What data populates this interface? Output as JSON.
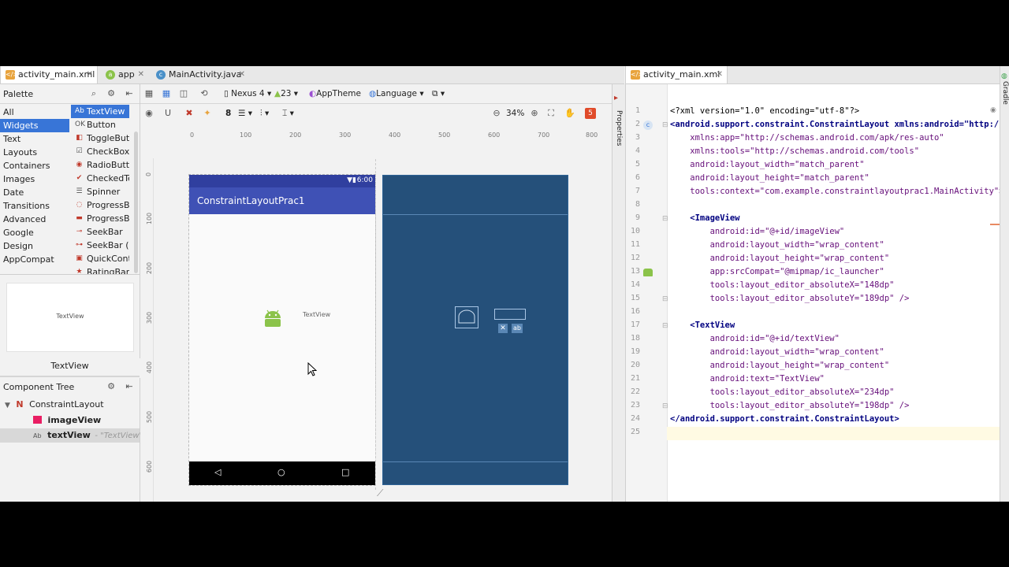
{
  "left_tabs": [
    {
      "label": "activity_main.xml",
      "icon": "xml-file-icon"
    },
    {
      "label": "app",
      "icon": "android-module-icon"
    },
    {
      "label": "MainActivity.java",
      "icon": "java-class-icon"
    }
  ],
  "right_tab": {
    "label": "activity_main.xml"
  },
  "palette": {
    "title": "Palette",
    "categories": [
      "All",
      "Widgets",
      "Text",
      "Layouts",
      "Containers",
      "Images",
      "Date",
      "Transitions",
      "Advanced",
      "Google",
      "Design",
      "AppCompat"
    ],
    "selected_category": "Widgets",
    "widgets": [
      "TextView",
      "Button",
      "ToggleButto",
      "CheckBox",
      "RadioButtor",
      "CheckedTex",
      "Spinner",
      "ProgressBar",
      "ProgressBar",
      "SeekBar",
      "SeekBar (Di",
      "QuickConta",
      "RatingBar"
    ],
    "preview_text": "TextView",
    "preview_caption": "TextView"
  },
  "toolbar": {
    "device": "Nexus 4",
    "api": "23",
    "theme": "AppTheme",
    "language": "Language",
    "margin": "8",
    "zoom": "34%",
    "error_count": "5"
  },
  "ruler": {
    "top": [
      "0",
      "100",
      "200",
      "300",
      "400",
      "500",
      "600",
      "700",
      "800"
    ],
    "left": [
      "0",
      "100",
      "200",
      "300",
      "400",
      "500",
      "600"
    ]
  },
  "phone": {
    "status_time": "6:00",
    "app_title": "ConstraintLayoutPrac1",
    "textview_text": "TextView"
  },
  "component_tree": {
    "title": "Component Tree",
    "root": "ConstraintLayout",
    "children": [
      {
        "name": "imageView",
        "hint": ""
      },
      {
        "name": "textView",
        "hint": "- \"TextView\""
      }
    ]
  },
  "side_strip": {
    "properties": "Properties",
    "gradle": "Gradle"
  },
  "editor": {
    "line_numbers": [
      "1",
      "2",
      "3",
      "4",
      "5",
      "6",
      "7",
      "8",
      "9",
      "10",
      "11",
      "12",
      "13",
      "14",
      "15",
      "16",
      "17",
      "18",
      "19",
      "20",
      "21",
      "22",
      "23",
      "24",
      "25"
    ],
    "lines": [
      "<?xml version=\"1.0\" encoding=\"utf-8\"?>",
      "<android.support.constraint.ConstraintLayout xmlns:android=\"http://",
      "    xmlns:app=\"http://schemas.android.com/apk/res-auto\"",
      "    xmlns:tools=\"http://schemas.android.com/tools\"",
      "    android:layout_width=\"match_parent\"",
      "    android:layout_height=\"match_parent\"",
      "    tools:context=\"com.example.constraintlayoutprac1.MainActivity\">",
      "",
      "    <ImageView",
      "        android:id=\"@+id/imageView\"",
      "        android:layout_width=\"wrap_content\"",
      "        android:layout_height=\"wrap_content\"",
      "        app:srcCompat=\"@mipmap/ic_launcher\"",
      "        tools:layout_editor_absoluteX=\"148dp\"",
      "        tools:layout_editor_absoluteY=\"189dp\" />",
      "",
      "    <TextView",
      "        android:id=\"@+id/textView\"",
      "        android:layout_width=\"wrap_content\"",
      "        android:layout_height=\"wrap_content\"",
      "        android:text=\"TextView\"",
      "        tools:layout_editor_absoluteX=\"234dp\"",
      "        tools:layout_editor_absoluteY=\"198dp\" />",
      "</android.support.constraint.ConstraintLayout>",
      ""
    ]
  },
  "colors": {
    "selection": "#3875d7",
    "app_bar": "#3f51b5",
    "status_bar": "#303f9f",
    "blueprint": "#1f4a74",
    "android_green": "#8bc34a"
  }
}
